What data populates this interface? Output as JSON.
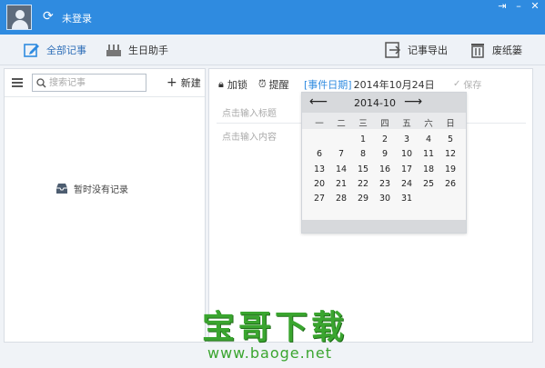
{
  "titlebar": {
    "login_status": "未登录",
    "accent": "#2f8be0"
  },
  "toolbar": {
    "all_notes": "全部记事",
    "birthday": "生日助手",
    "export": "记事导出",
    "trash": "废纸篓"
  },
  "left": {
    "search_placeholder": "搜索记事",
    "new_label": "新建",
    "empty_message": "暂时没有记录"
  },
  "editor": {
    "encrypt": "加锁",
    "remind": "提醒",
    "event_date_tag": "[事件日期]",
    "event_date": "2014年10月24日",
    "save": "保存",
    "title_placeholder": "点击输入标题",
    "content_placeholder": "点击输入内容"
  },
  "calendar": {
    "prev": "⟵",
    "next": "⟶",
    "month": "2014-10",
    "weekdays": [
      "一",
      "二",
      "三",
      "四",
      "五",
      "六",
      "日"
    ],
    "weeks": [
      [
        "",
        "",
        "1",
        "2",
        "3",
        "4",
        "5"
      ],
      [
        "6",
        "7",
        "8",
        "9",
        "10",
        "11",
        "12"
      ],
      [
        "13",
        "14",
        "15",
        "16",
        "17",
        "18",
        "19"
      ],
      [
        "20",
        "21",
        "22",
        "23",
        "24",
        "25",
        "26"
      ],
      [
        "27",
        "28",
        "29",
        "30",
        "31",
        "",
        ""
      ]
    ]
  },
  "watermark": {
    "brand": "宝哥下载",
    "url": "www.baoge.net",
    "color": "#3aa52f"
  }
}
